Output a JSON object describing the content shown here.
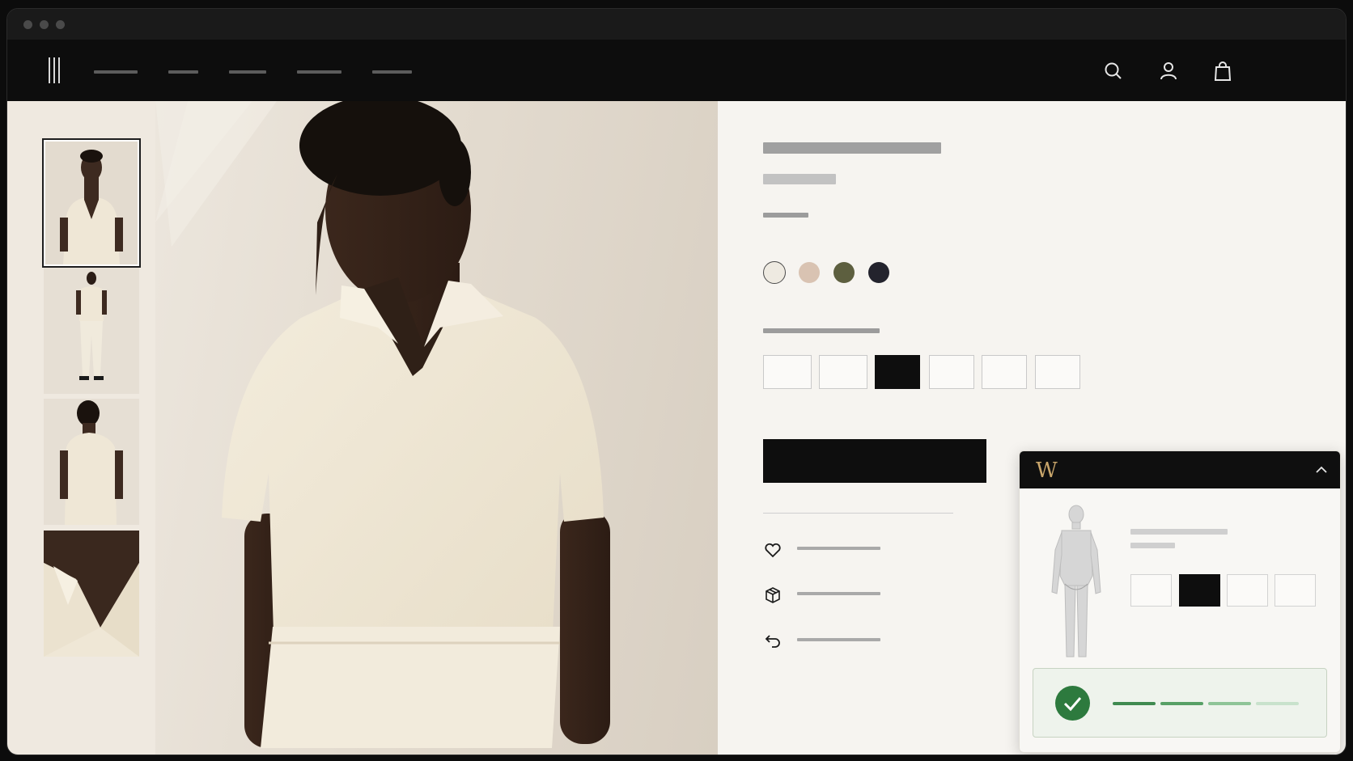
{
  "window": {
    "traffic_lights": [
      "close",
      "minimize",
      "maximize"
    ]
  },
  "nav": {
    "logo_icon": "brand-bars-logo",
    "links": [
      "",
      "",
      "",
      "",
      ""
    ],
    "icons": [
      "search-icon",
      "user-icon",
      "bag-icon"
    ]
  },
  "gallery": {
    "thumbnails": [
      "front-view",
      "full-body-view",
      "back-view",
      "collar-detail-view"
    ],
    "active_index": 0
  },
  "product": {
    "title": "",
    "price": "",
    "color_label": "",
    "colors": [
      "#eeeae1",
      "#d9c3b2",
      "#5d5f3f",
      "#23232d"
    ],
    "selected_color_index": 0,
    "size_label": "",
    "sizes": [
      "",
      "",
      "",
      "",
      "",
      ""
    ],
    "selected_size_index": 2,
    "add_to_bag_label": "",
    "perks": [
      {
        "icon": "heart-icon",
        "label": ""
      },
      {
        "icon": "package-icon",
        "label": ""
      },
      {
        "icon": "return-icon",
        "label": ""
      }
    ]
  },
  "fit_widget": {
    "logo_text": "W",
    "expanded": true,
    "recommended_sizes": [
      "",
      "",
      "",
      ""
    ],
    "selected_size_index": 1,
    "fit_confidence": 0.85,
    "colors": {
      "header": "#0f0f0f",
      "logo": "#c9a66b",
      "success": "#2d7a3e"
    }
  }
}
